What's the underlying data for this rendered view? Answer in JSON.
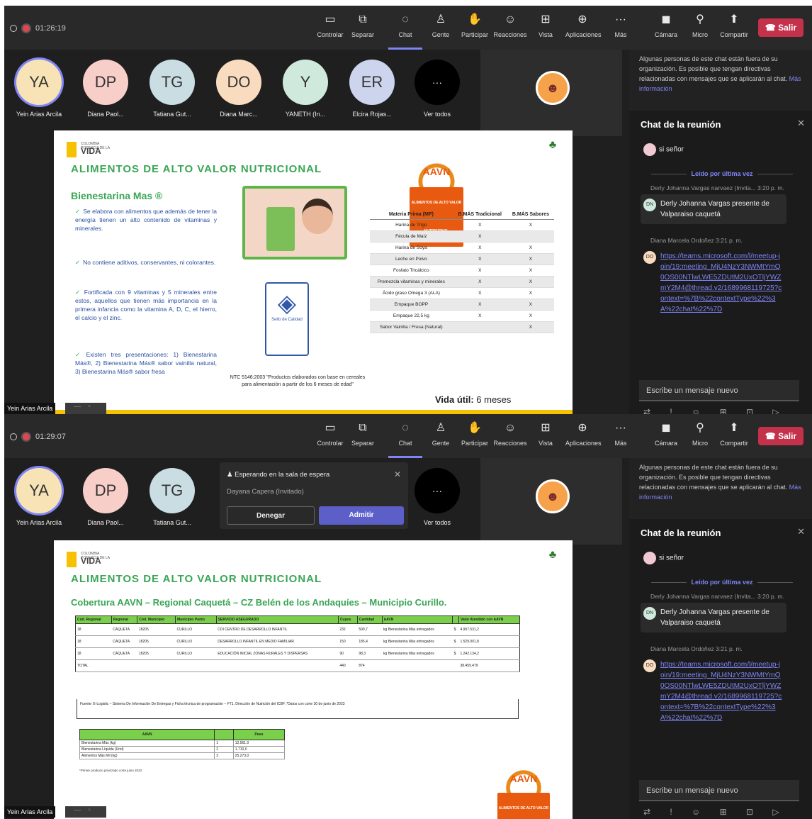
{
  "shot1": {
    "timer": "01:26:19",
    "toolbar": [
      {
        "icon": "screen-share-icon",
        "label": "Controlar"
      },
      {
        "icon": "pop-out-icon",
        "label": "Separar"
      },
      {
        "icon": "chat-icon",
        "label": "Chat"
      },
      {
        "icon": "people-icon",
        "label": "Gente"
      },
      {
        "icon": "raise-hand-icon",
        "label": "Participar"
      },
      {
        "icon": "react-icon",
        "label": "Reacciones"
      },
      {
        "icon": "view-icon",
        "label": "Vista"
      },
      {
        "icon": "apps-icon",
        "label": "Aplicaciones"
      },
      {
        "icon": "more-icon",
        "label": "Más"
      },
      {
        "icon": "camera-off-icon",
        "label": "Cámara"
      },
      {
        "icon": "mic-off-icon",
        "label": "Micro"
      },
      {
        "icon": "share-icon",
        "label": "Compartir"
      }
    ],
    "leave": "Salir",
    "participants": [
      {
        "initials": "YA",
        "name": "Yein Arias Arcila",
        "color": "#f7e3b5"
      },
      {
        "initials": "DP",
        "name": "Diana Paol...",
        "color": "#f7cfc8"
      },
      {
        "initials": "TG",
        "name": "Tatiana Gut...",
        "color": "#c9dde3"
      },
      {
        "initials": "DO",
        "name": "Diana Marc...",
        "color": "#f9dcc0"
      },
      {
        "initials": "Y",
        "name": "YANETH (In...",
        "color": "#cfe9dc"
      },
      {
        "initials": "ER",
        "name": "Elcira Rojas...",
        "color": "#cdd5ee"
      }
    ],
    "see_all": "Ver todos",
    "more_count": "···",
    "self_name": "Yein Arias Arcila"
  },
  "chat": {
    "notice": "Algunas personas de este chat están fuera de su organización. Es posible que tengan directivas relacionadas con mensajes que se aplicarán al chat.",
    "notice_link": "Más información",
    "title": "Chat de la reunión",
    "msg1": "si señor",
    "read_by": "Leído por última vez",
    "meta1": "Derly Johanna Vargas narvaez (Invita...   3:20 p. m.",
    "bubble1": "Derly Johanna Vargas presente de Valparaiso caquetá",
    "meta2": "Diana Marcela Ordoñez  3:21 p. m.",
    "link": "https://teams.microsoft.com/l/meetup-join/19:meeting_MjU4NzY3NWMtYmQ0OS00NTlwLWE5ZDUtM2UxOTljYWZmY2M4@thread.v2/1689968119725?context=%7B%22contextType%22%3A%22chat%22%7D",
    "compose": "Escribe un mensaje nuevo",
    "tools": "⇄ ! ☺ ⊞ ⊡ ▷ ···"
  },
  "slide1": {
    "brand_small": "COLOMBIA POTENCIA DE LA",
    "brand": "VIDA",
    "title": "ALIMENTOS DE ALTO VALOR NUTRICIONAL",
    "subtitle": "Bienestarina Mas ®",
    "bullets": [
      "Se elabora con alimentos que además de tener la energía tienen un alto contenido de vitaminas y minerales.",
      "No contiene aditivos, conservantes, ni colorantes.",
      "Fortificada con 9 vitaminas y 5 minerales entre estos, aquellos que tienen más importancia en la primera infancia como la vitamina A, D, C, el hierro, el calcio y el zinc.",
      "Existen tres presentaciones: 1) Bienestarina Más®, 2) Bienestarina Más® sabor vainilla natural, 3) Bienestarina Más® sabor fresa"
    ],
    "aavn": "AAVN",
    "aavn_banner": "ALIMENTOS DE ALTO VALOR NUTRICIONAL",
    "seal_text": "Sello de Calidad",
    "ntc": "NTC 5146:2003 \"Productos elaborados con base en cereales para alimentación a partir de los 6 meses de edad\"",
    "table_headers": [
      "Materia Prima (MP)",
      "B.MÁS Tradicional",
      "B.MÁS Sabores"
    ],
    "table_rows": [
      [
        "Harina de Trigo",
        "X",
        "X"
      ],
      [
        "Fécula de Maíz",
        "X",
        ""
      ],
      [
        "Harina de Soya",
        "X",
        "X"
      ],
      [
        "Leche en Polvo",
        "X",
        "X"
      ],
      [
        "Fosfato Tricálcico",
        "X",
        "X"
      ],
      [
        "Premezcla vitaminas y minerales",
        "X",
        "X"
      ],
      [
        "Ácido graso Omega 3 (ALA)",
        "X",
        "X"
      ],
      [
        "Empaque BOPP",
        "X",
        "X"
      ],
      [
        "Empaque 22,5 kg",
        "X",
        "X"
      ],
      [
        "Sabor Vainilla / Fresa (Natural)",
        "",
        "X"
      ]
    ],
    "vida_label": "Vida útil:",
    "vida_value": "6 meses"
  },
  "shot2": {
    "timer": "01:29:07",
    "participants": [
      {
        "initials": "YA",
        "name": "Yein Arias Arcila",
        "color": "#f7e3b5"
      },
      {
        "initials": "DP",
        "name": "Diana Paol...",
        "color": "#f7cfc8"
      },
      {
        "initials": "TG",
        "name": "Tatiana Gut...",
        "color": "#c9dde3"
      }
    ],
    "lobby_title": "Esperando en la sala de espera",
    "lobby_name": "Dayana Capera (Invitado)",
    "deny": "Denegar",
    "admit": "Admitir",
    "see_all": "Ver todos",
    "self_name": "Yein Arias Arcila"
  },
  "slide2": {
    "title": "ALIMENTOS DE ALTO VALOR NUTRICIONAL",
    "subtitle": "Cobertura AAVN – Regional Caquetá – CZ Belén de los Andaquíes – Municipio Curillo.",
    "cov_headers": [
      "Cód. Regional",
      "Regional",
      "Cód. Municipio",
      "Municipio Punto",
      "SERVICIO ASEGURADO",
      "Cupos",
      "Cantidad",
      "AAVN",
      "",
      "Valor Atendido con AAVN"
    ],
    "cov_rows": [
      [
        "18",
        "CAQUETA",
        "18205",
        "CURILLO",
        "CDI CENTRO DE DESARROLLO INFANTIL",
        "232",
        "590,7",
        "kg Bienestarina Más entregados",
        "$",
        "4.907.531,2"
      ],
      [
        "18",
        "CAQUETA",
        "18205",
        "CURILLO",
        "DESARROLLO INFANTIL EN MEDIO FAMILIAR",
        "150",
        "185,4",
        "kg Bienestarina Más entregados",
        "$",
        "1.529.001,8"
      ],
      [
        "18",
        "CAQUETA",
        "18205",
        "CURILLO",
        "EDUCACIÓN INICIAL ZONAS RURALES Y DISPERSAS",
        "90",
        "98,3",
        "kg Bienestarina Más entregados",
        "$",
        "1.242.134,2"
      ],
      [
        "TOTAL",
        "",
        "",
        "",
        "",
        "440",
        "874",
        "",
        "",
        "38.459.479"
      ]
    ],
    "source": "Fuente: E-Logistic – Sistema De Información De Entregas y Ficha técnica de programación – FT1. Dirección de Nutrición del ICBF. *Datos con corte 30 de junio de 2023",
    "small_headers": [
      "AAVN",
      "",
      "Peso"
    ],
    "small_rows": [
      [
        "Bienestarina Más (kg)",
        "1",
        "12.561,0"
      ],
      [
        "Bienestarina Líquida (Und)",
        "2",
        "1.710,0"
      ],
      [
        "Alimentos Más Mil (kg)",
        "3",
        "25.273,0"
      ]
    ],
    "small_note": "*Primer producto priorizado corte junio 2023"
  }
}
